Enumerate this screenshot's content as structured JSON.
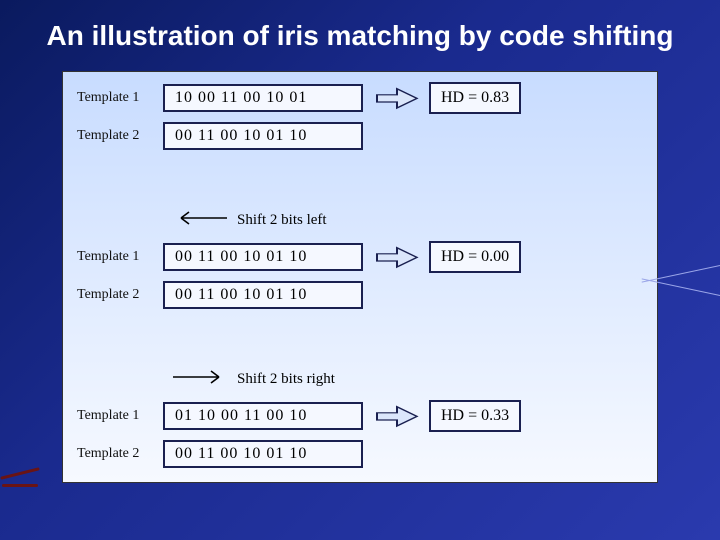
{
  "title": "An illustration of iris matching by code shifting",
  "groups": [
    {
      "rows": [
        {
          "label": "Template 1",
          "code": "10 00 11 00 10 01"
        },
        {
          "label": "Template 2",
          "code": "00 11 00 10 01 10"
        }
      ],
      "hd": "HD = 0.83"
    },
    {
      "shift": {
        "direction": "left",
        "text": "Shift 2 bits left"
      },
      "rows": [
        {
          "label": "Template 1",
          "code": "00 11 00 10 01 10"
        },
        {
          "label": "Template 2",
          "code": "00 11 00 10 01 10"
        }
      ],
      "hd": "HD = 0.00"
    },
    {
      "shift": {
        "direction": "right",
        "text": "Shift 2 bits right"
      },
      "rows": [
        {
          "label": "Template 1",
          "code": "01 10 00 11 00 10"
        },
        {
          "label": "Template 2",
          "code": "00 11 00 10 01 10"
        }
      ],
      "hd": "HD = 0.33"
    }
  ]
}
